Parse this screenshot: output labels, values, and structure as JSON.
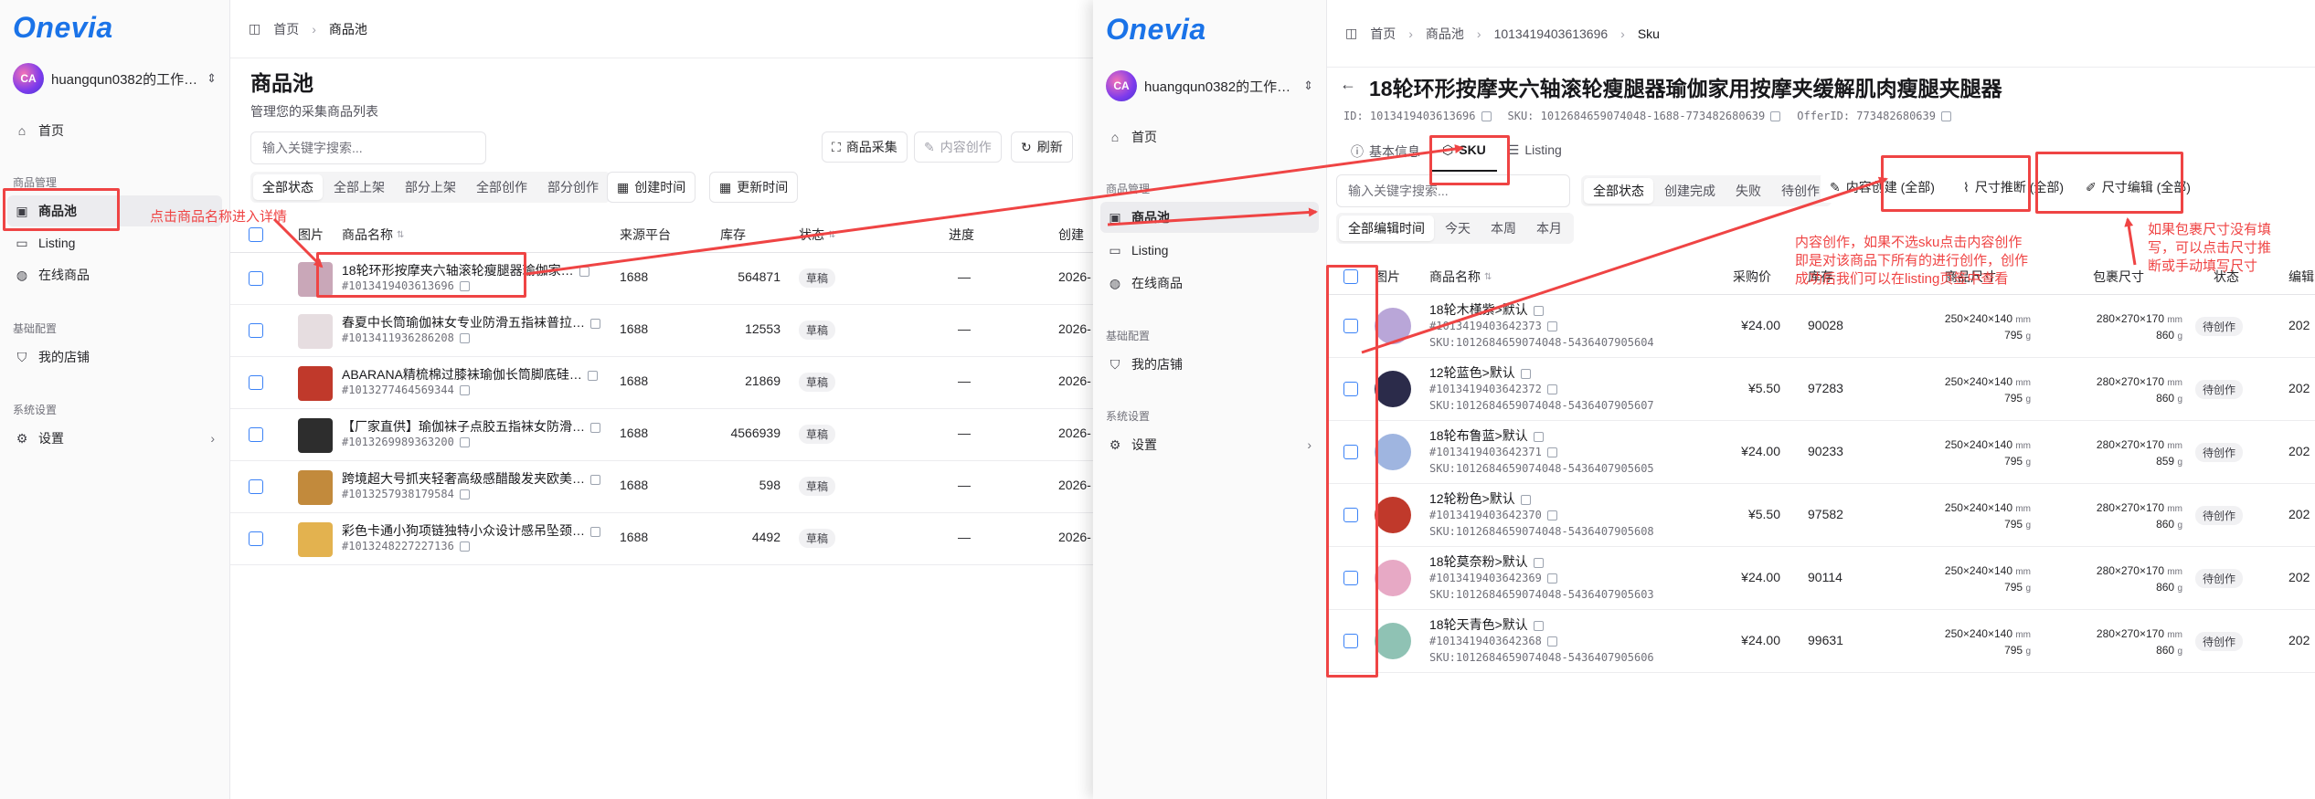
{
  "brand": {
    "logo": "Onevia",
    "accent": "#1a73e8",
    "annotation_color": "#ef4444"
  },
  "workspace": {
    "name": "huangqun0382的工作…",
    "name_right": "huangqun0382的工作…",
    "avatar_text": "CA"
  },
  "sidebar": {
    "home": "首页",
    "group_product": "商品管理",
    "product_pool": "商品池",
    "listing": "Listing",
    "online": "在线商品",
    "group_base": "基础配置",
    "my_store": "我的店铺",
    "group_system": "系统设置",
    "settings": "设置"
  },
  "left": {
    "breadcrumb": [
      "首页",
      "商品池"
    ],
    "title": "商品池",
    "subtitle": "管理您的采集商品列表",
    "search_placeholder": "输入关键字搜索...",
    "buttons": {
      "collect": "商品采集",
      "create": "内容创作",
      "refresh": "刷新"
    },
    "status_tabs": [
      "全部状态",
      "全部上架",
      "部分上架",
      "全部创作",
      "部分创作"
    ],
    "date_filters": [
      "创建时间",
      "更新时间"
    ],
    "columns": {
      "image": "图片",
      "name": "商品名称",
      "platform": "来源平台",
      "stock": "库存",
      "status": "状态",
      "progress": "进度",
      "created": "创建"
    },
    "rows": [
      {
        "name": "18轮环形按摩夹六轴滚轮瘦腿器瑜伽家…",
        "id": "#1013419403613696",
        "platform": "1688",
        "stock": "564871",
        "status": "草稿",
        "progress": "—",
        "created": "2026-"
      },
      {
        "name": "春夏中长筒瑜伽袜女专业防滑五指袜普拉…",
        "id": "#1013411936286208",
        "platform": "1688",
        "stock": "12553",
        "status": "草稿",
        "progress": "—",
        "created": "2026-"
      },
      {
        "name": "ABARANA精梳棉过膝袜瑜伽长筒脚底硅…",
        "id": "#1013277464569344",
        "platform": "1688",
        "stock": "21869",
        "status": "草稿",
        "progress": "—",
        "created": "2026-"
      },
      {
        "name": "【厂家直供】瑜伽袜子点胶五指袜女防滑…",
        "id": "#1013269989363200",
        "platform": "1688",
        "stock": "4566939",
        "status": "草稿",
        "progress": "—",
        "created": "2026-"
      },
      {
        "name": "跨境超大号抓夹轻奢高级感醋酸发夹欧美…",
        "id": "#1013257938179584",
        "platform": "1688",
        "stock": "598",
        "status": "草稿",
        "progress": "—",
        "created": "2026-"
      },
      {
        "name": "彩色卡通小狗项链独特小众设计感吊坠颈…",
        "id": "#1013248227227136",
        "platform": "1688",
        "stock": "4492",
        "status": "草稿",
        "progress": "—",
        "created": "2026-"
      }
    ],
    "annotation": "点击商品名称进入详情"
  },
  "right": {
    "breadcrumb": [
      "首页",
      "商品池",
      "1013419403613696",
      "Sku"
    ],
    "title": "18轮环形按摩夹六轴滚轮瘦腿器瑜伽家用按摩夹缓解肌肉瘦腿夹腿器",
    "meta": {
      "id": "ID: 1013419403613696",
      "sku": "SKU: 1012684659074048-1688-773482680639",
      "offer": "OfferID: 773482680639"
    },
    "tabs": [
      "基本信息",
      "SKU",
      "Listing"
    ],
    "search_placeholder": "输入关键字搜索...",
    "status_tabs": [
      "全部状态",
      "创建完成",
      "失败",
      "待创作"
    ],
    "time_tabs": [
      "全部编辑时间",
      "今天",
      "本周",
      "本月"
    ],
    "buttons": {
      "create": "内容创建 (全部)",
      "size_infer": "尺寸推断 (全部)",
      "size_edit": "尺寸编辑 (全部)"
    },
    "columns": {
      "image": "图片",
      "name": "商品名称",
      "price": "采购价",
      "stock": "库存",
      "size": "商品尺寸",
      "pack": "包裹尺寸",
      "status": "状态",
      "edit": "编辑"
    },
    "rows": [
      {
        "name": "18轮木槿紫>默认",
        "id": "#1013419403642373",
        "sku": "SKU:1012684659074048-5436407905604",
        "price": "¥24.00",
        "stock": "90028",
        "size": "250×240×140",
        "weight": "795",
        "pack": "280×270×170",
        "pack_weight": "860",
        "status": "待创作",
        "edit": "202"
      },
      {
        "name": "12轮蓝色>默认",
        "id": "#1013419403642372",
        "sku": "SKU:1012684659074048-5436407905607",
        "price": "¥5.50",
        "stock": "97283",
        "size": "250×240×140",
        "weight": "795",
        "pack": "280×270×170",
        "pack_weight": "860",
        "status": "待创作",
        "edit": "202"
      },
      {
        "name": "18轮布鲁蓝>默认",
        "id": "#1013419403642371",
        "sku": "SKU:1012684659074048-5436407905605",
        "price": "¥24.00",
        "stock": "90233",
        "size": "250×240×140",
        "weight": "795",
        "pack": "280×270×170",
        "pack_weight": "859",
        "status": "待创作",
        "edit": "202"
      },
      {
        "name": "12轮粉色>默认",
        "id": "#1013419403642370",
        "sku": "SKU:1012684659074048-5436407905608",
        "price": "¥5.50",
        "stock": "97582",
        "size": "250×240×140",
        "weight": "795",
        "pack": "280×270×170",
        "pack_weight": "860",
        "status": "待创作",
        "edit": "202"
      },
      {
        "name": "18轮莫奈粉>默认",
        "id": "#1013419403642369",
        "sku": "SKU:1012684659074048-5436407905603",
        "price": "¥24.00",
        "stock": "90114",
        "size": "250×240×140",
        "weight": "795",
        "pack": "280×270×170",
        "pack_weight": "860",
        "status": "待创作",
        "edit": "202"
      },
      {
        "name": "18轮天青色>默认",
        "id": "#1013419403642368",
        "sku": "SKU:1012684659074048-5436407905606",
        "price": "¥24.00",
        "stock": "99631",
        "size": "250×240×140",
        "weight": "795",
        "pack": "280×270×170",
        "pack_weight": "860",
        "status": "待创作",
        "edit": "202"
      }
    ],
    "units": {
      "mm": "mm",
      "g": "g"
    },
    "annotation_create": [
      "内容创作，如果不选sku点击内容创作",
      "即是对该商品下所有的进行创作，创作",
      "成功后我们可以在listing页签中查看"
    ],
    "annotation_size": [
      "如果包裹尺寸没有填",
      "写，可以点击尺寸推",
      "断或手动填写尺寸"
    ]
  }
}
